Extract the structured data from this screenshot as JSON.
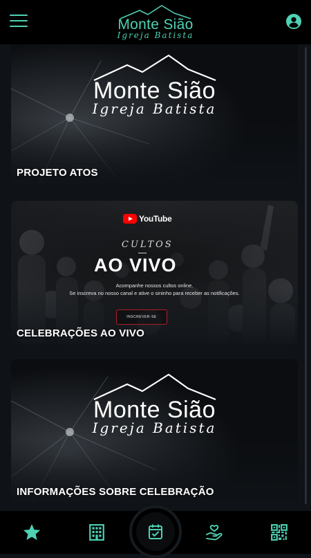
{
  "header": {
    "logo_title": "Monte Sião",
    "logo_subtitle": "Igreja Batista"
  },
  "cards": [
    {
      "title": "PROJETO ATOS",
      "logo_title": "Monte Sião",
      "logo_subtitle": "Igreja Batista"
    },
    {
      "title": "CELEBRAÇÕES AO VIVO",
      "youtube_label": "YouTube",
      "cultos": "CULTOS",
      "ao_vivo": "AO VIVO",
      "description_1": "Acompanhe nossos cultos online.",
      "description_2": "Se inscreva no nosso canal e ative o sininho para receber as notificações.",
      "subscribe_label": "INSCREVER-SE"
    },
    {
      "title": "INFORMAÇÕES SOBRE CELEBRAÇÃO",
      "logo_title": "Monte Sião",
      "logo_subtitle": "Igreja Batista"
    }
  ],
  "nav": {
    "items": [
      "star-icon",
      "building-icon",
      "calendar-check-icon",
      "heart-hand-icon",
      "qr-code-icon"
    ],
    "accent_color": "#4fd1b4"
  }
}
